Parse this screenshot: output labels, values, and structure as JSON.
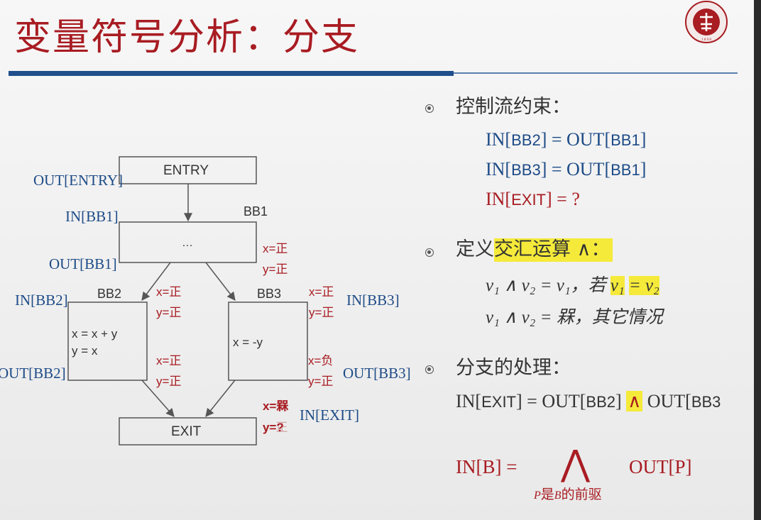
{
  "slide": {
    "title": "变量符号分析：分支",
    "logo_icon": "peking-university-seal",
    "logo_text": "PEKING UNIVERSITY 1898"
  },
  "diagram": {
    "nodes": {
      "entry": "ENTRY",
      "bb1_label": "BB1",
      "bb1_body": "…",
      "bb2_label": "BB2",
      "bb2_line1": "x = x + y",
      "bb2_line2": "y = x",
      "bb3_label": "BB3",
      "bb3_body": "x = -y",
      "exit": "EXIT"
    },
    "blue_labels": {
      "out_entry": "OUT[ENTRY]",
      "in_bb1": "IN[BB1]",
      "out_bb1": "OUT[BB1]",
      "in_bb2": "IN[BB2]",
      "out_bb2": "OUT[BB2]",
      "in_bb3": "IN[BB3]",
      "out_bb3": "OUT[BB3]",
      "in_exit": "IN[EXIT]"
    },
    "red_values": {
      "out_bb1_x": "x=正",
      "out_bb1_y": "y=正",
      "in_bb2_x": "x=正",
      "in_bb2_y": "y=正",
      "out_bb2_x": "x=正",
      "out_bb2_y": "y=正",
      "in_bb3_x": "x=正",
      "in_bb3_y": "y=正",
      "out_bb3_x": "x=负",
      "out_bb3_y": "y=正",
      "exit_x_new": "x=槑",
      "exit_x_old": "x=负",
      "exit_y_new": "y=?",
      "exit_y_old": "y=正"
    }
  },
  "content": {
    "b1_heading": "控制流约束：",
    "b1_eq1_in": "IN[",
    "b1_eq1_bb": "BB2",
    "b1_eq1_mid": "] = OUT[",
    "b1_eq1_bb2": "BB1",
    "b1_eq1_end": "]",
    "b1_eq2_in": "IN[",
    "b1_eq2_bb": "BB3",
    "b1_eq2_mid": "] = OUT[",
    "b1_eq2_bb2": "BB1",
    "b1_eq2_end": "]",
    "b1_eq3_in": "IN[",
    "b1_eq3_bb": "EXIT",
    "b1_eq3_end": "] = ?",
    "b2_heading_pre": "定义",
    "b2_heading_hl": "交汇运算 ∧：",
    "b2_rule1_lhs": "v₁ ∧ v₂ = v₁，若",
    "b2_rule1_v1": "v₁",
    "b2_rule1_eq": "= v₂",
    "b2_rule2": "v₁ ∧ v₂ = 槑，其它情况",
    "b3_heading": "分支的处理：",
    "b3_eq_a": "IN[",
    "b3_eq_exit": "EXIT",
    "b3_eq_b": "] = OUT[",
    "b3_eq_bb2": "BB2",
    "b3_eq_c": "] ",
    "b3_eq_wedge": "∧",
    "b3_eq_d": " OUT[",
    "b3_eq_bb3": "BB3",
    "b3_formula_lhs": "IN[B] =",
    "b3_formula_op": "⋀",
    "b3_formula_rhs": "OUT[P]",
    "b3_formula_sub_p": "P",
    "b3_formula_sub_mid": "是",
    "b3_formula_sub_b": "B",
    "b3_formula_sub_end": "的前驱"
  }
}
